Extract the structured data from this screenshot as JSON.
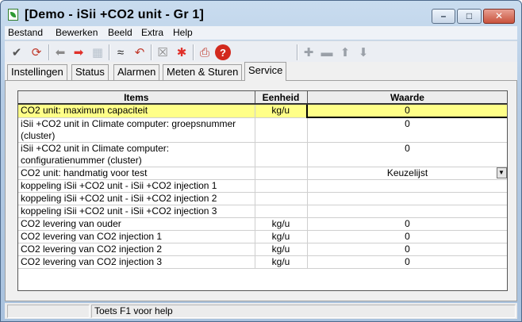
{
  "window": {
    "title": "[Demo - iSii +CO2 unit - Gr 1]"
  },
  "window_buttons": {
    "minimize": "–",
    "maximize": "□",
    "close": "✕"
  },
  "menu": [
    "Bestand",
    "Bewerken",
    "Beeld",
    "Extra",
    "Help"
  ],
  "toolbar": [
    {
      "icon": "checkmark-icon",
      "glyph": "✔",
      "color": "#555555"
    },
    {
      "icon": "refresh-icon",
      "glyph": "⟳",
      "color": "#c0392b"
    },
    {
      "icon": "arrow-left-icon",
      "glyph": "⬅",
      "color": "#8a8a8a"
    },
    {
      "icon": "arrow-right-icon",
      "glyph": "➡",
      "color": "#e0302a"
    },
    {
      "icon": "grid-icon",
      "glyph": "▦",
      "color": "#b8c2cc"
    },
    {
      "icon": "collapse-icon",
      "glyph": "≈",
      "color": "#222222"
    },
    {
      "icon": "undo-icon",
      "glyph": "↶",
      "color": "#c0392b"
    },
    {
      "icon": "box-x-icon",
      "glyph": "☒",
      "color": "#8a8a8a"
    },
    {
      "icon": "asterisk-icon",
      "glyph": "✱",
      "color": "#e0302a"
    },
    {
      "icon": "print-icon",
      "glyph": "⎙",
      "color": "#c0392b"
    },
    {
      "icon": "help-icon",
      "glyph": "?",
      "color": "#ffffff"
    },
    {
      "icon": "plus-icon",
      "glyph": "✚",
      "color": "#9aa0a8"
    },
    {
      "icon": "minus-icon",
      "glyph": "▬",
      "color": "#9aa0a8"
    },
    {
      "icon": "arrow-up-icon",
      "glyph": "⬆",
      "color": "#9aa0a8"
    },
    {
      "icon": "arrow-down-icon",
      "glyph": "⬇",
      "color": "#9aa0a8"
    }
  ],
  "tabs": [
    {
      "label": "Instellingen",
      "active": false
    },
    {
      "label": "Status",
      "active": false
    },
    {
      "label": "Alarmen",
      "active": false
    },
    {
      "label": "Meten & Sturen",
      "active": false
    },
    {
      "label": "Service",
      "active": true
    }
  ],
  "grid": {
    "columns": [
      "Items",
      "Eenheid",
      "Waarde"
    ],
    "rows": [
      {
        "item": "CO2 unit: maximum capaciteit",
        "unit": "kg/u",
        "value": "0",
        "selected": true
      },
      {
        "item": "iSii +CO2 unit in Climate computer: groepsnummer (cluster)",
        "unit": "",
        "value": "0"
      },
      {
        "item": "iSii +CO2 unit in Climate computer: configuratienummer (cluster)",
        "unit": "",
        "value": "0"
      },
      {
        "item": "CO2 unit: handmatig voor test",
        "unit": "",
        "value": "Keuzelijst",
        "dropdown": true
      },
      {
        "item": "koppeling iSii +CO2 unit - iSii +CO2 injection 1",
        "unit": "",
        "value": ""
      },
      {
        "item": "koppeling iSii +CO2 unit - iSii +CO2 injection 2",
        "unit": "",
        "value": ""
      },
      {
        "item": "koppeling iSii +CO2 unit - iSii +CO2 injection 3",
        "unit": "",
        "value": ""
      },
      {
        "item": "CO2 levering van ouder",
        "unit": "kg/u",
        "value": "0"
      },
      {
        "item": "CO2  levering van CO2 injection 1",
        "unit": "kg/u",
        "value": "0"
      },
      {
        "item": "CO2  levering van CO2 injection 2",
        "unit": "kg/u",
        "value": "0"
      },
      {
        "item": "CO2  levering van CO2 injection 3",
        "unit": "kg/u",
        "value": "0"
      }
    ]
  },
  "statusbar": {
    "text": "Toets F1 voor help"
  }
}
